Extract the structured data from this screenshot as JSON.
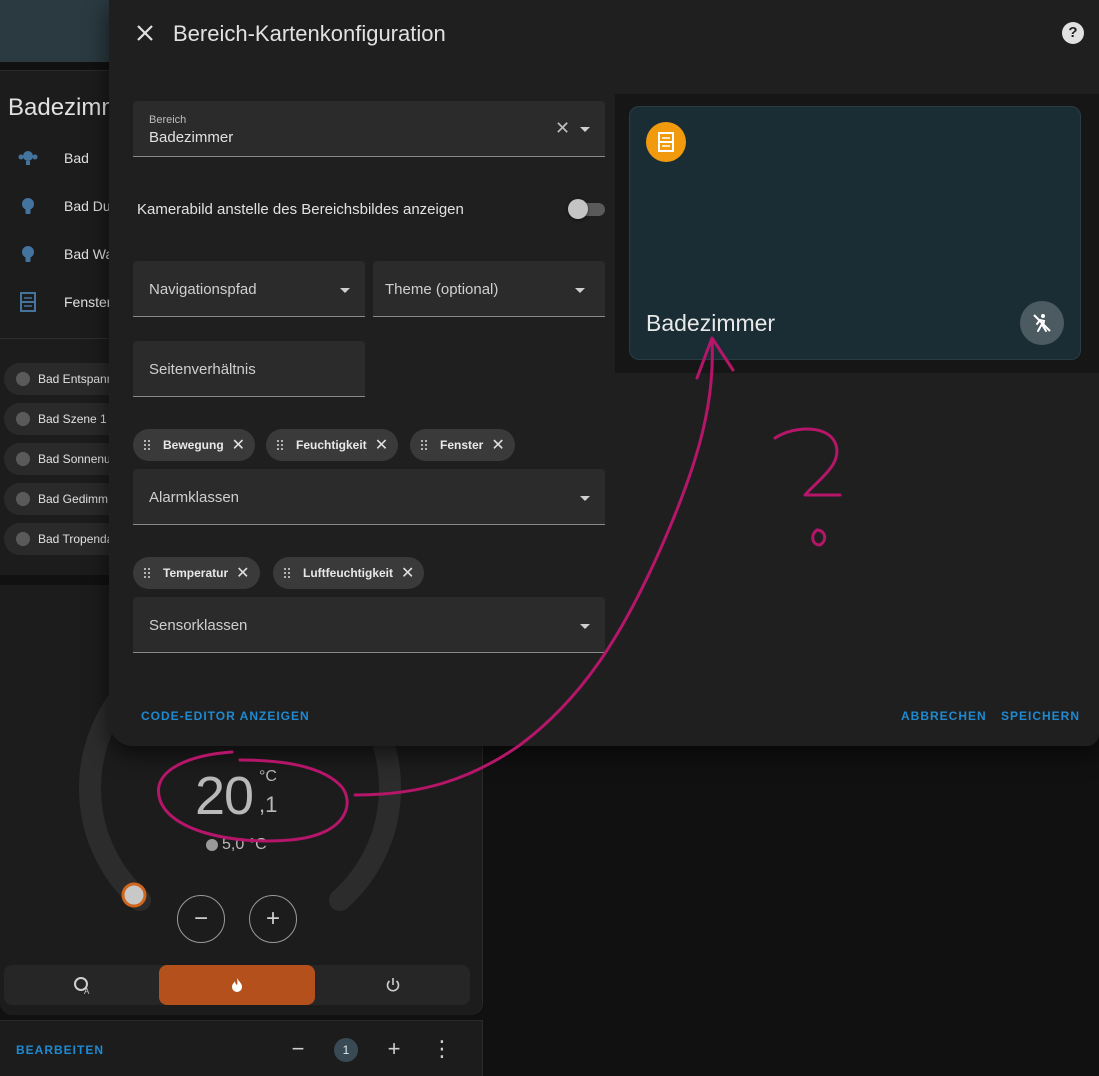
{
  "background": {
    "card_title": "Badezimm",
    "entities": [
      {
        "label": "Bad",
        "icon": "lamp-group-icon"
      },
      {
        "label": "Bad Du",
        "icon": "bulb-icon"
      },
      {
        "label": "Bad Wa",
        "icon": "bulb-icon"
      },
      {
        "label": "Fenster",
        "icon": "window-icon"
      }
    ],
    "scenes": [
      "Bad Entspann",
      "Bad Szene 1",
      "Bad Sonnenu",
      "Bad Gedimm",
      "Bad Tropenda"
    ],
    "thermostat": {
      "temperature": "20",
      "unit": "°C",
      "decimal": ",1",
      "target": "5,0 °C",
      "minus": "−",
      "plus": "+"
    },
    "modes": {
      "auto": "A",
      "heat": "🔥",
      "off": "⏻"
    },
    "footer": {
      "edit": "BEARBEITEN",
      "minus": "−",
      "page": "1",
      "plus": "+",
      "menu": "⋮"
    }
  },
  "dialog": {
    "title": "Bereich-Kartenkonfiguration",
    "help": "?",
    "area": {
      "label": "Bereich",
      "value": "Badezimmer"
    },
    "camera_toggle": {
      "label": "Kamerabild anstelle des Bereichsbildes anzeigen",
      "on": false
    },
    "navigation": {
      "placeholder": "Navigationspfad"
    },
    "theme": {
      "placeholder": "Theme (optional)"
    },
    "aspect": {
      "placeholder": "Seitenverhältnis"
    },
    "alarm_chips": [
      "Bewegung",
      "Feuchtigkeit",
      "Fenster"
    ],
    "alarm_classes": {
      "placeholder": "Alarmklassen"
    },
    "sensor_chips": [
      "Temperatur",
      "Luftfeuchtigkeit"
    ],
    "sensor_classes": {
      "placeholder": "Sensorklassen"
    },
    "code_editor": "CODE-EDITOR ANZEIGEN",
    "cancel": "ABBRECHEN",
    "save": "SPEICHERN"
  },
  "preview": {
    "name": "Badezimmer",
    "icon": "window-icon",
    "action_icon": "motion-off-icon",
    "accent": "#f29a0e"
  },
  "annotation": {
    "question_mark": "?",
    "color": "#b5166a"
  }
}
